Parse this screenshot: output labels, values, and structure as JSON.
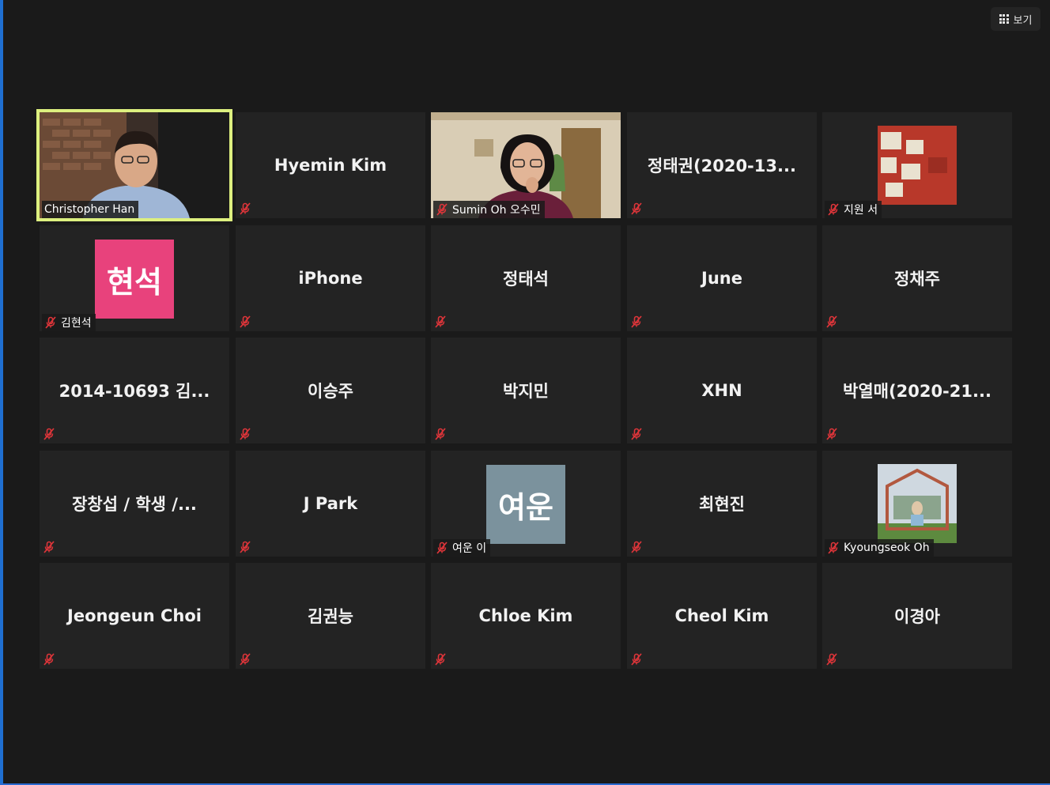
{
  "toolbar": {
    "view_label": "보기",
    "view_icon": "grid-icon"
  },
  "colors": {
    "active_speaker": "#ddf07f",
    "mute_red": "#e0353a"
  },
  "participants": [
    {
      "name": "Christopher Han",
      "type": "video",
      "active": true
    },
    {
      "name": "Hyemin Kim",
      "type": "name"
    },
    {
      "name": "Sumin Oh 오수민",
      "type": "video"
    },
    {
      "name": "정태권(2020-13...",
      "type": "name"
    },
    {
      "name": "지원 서",
      "type": "photo"
    },
    {
      "name": "김현석",
      "type": "avatar",
      "avatar_text": "현석",
      "avatar_color": "#e8427c"
    },
    {
      "name": "iPhone",
      "type": "name"
    },
    {
      "name": "정태석",
      "type": "name"
    },
    {
      "name": "June",
      "type": "name"
    },
    {
      "name": "정채주",
      "type": "name"
    },
    {
      "name": "2014-10693 김...",
      "type": "name"
    },
    {
      "name": "이승주",
      "type": "name"
    },
    {
      "name": "박지민",
      "type": "name"
    },
    {
      "name": "XHN",
      "type": "name"
    },
    {
      "name": "박열매(2020-21...",
      "type": "name"
    },
    {
      "name": "장창섭 / 학생 /...",
      "type": "name"
    },
    {
      "name": "J Park",
      "type": "name"
    },
    {
      "name": "여운 이",
      "type": "avatar",
      "avatar_text": "여운",
      "avatar_color": "#7b929d"
    },
    {
      "name": "최현진",
      "type": "name"
    },
    {
      "name": "Kyoungseok Oh",
      "type": "photo"
    },
    {
      "name": "Jeongeun Choi",
      "type": "name"
    },
    {
      "name": "김권능",
      "type": "name"
    },
    {
      "name": "Chloe Kim",
      "type": "name"
    },
    {
      "name": "Cheol Kim",
      "type": "name"
    },
    {
      "name": "이경아",
      "type": "name"
    }
  ]
}
